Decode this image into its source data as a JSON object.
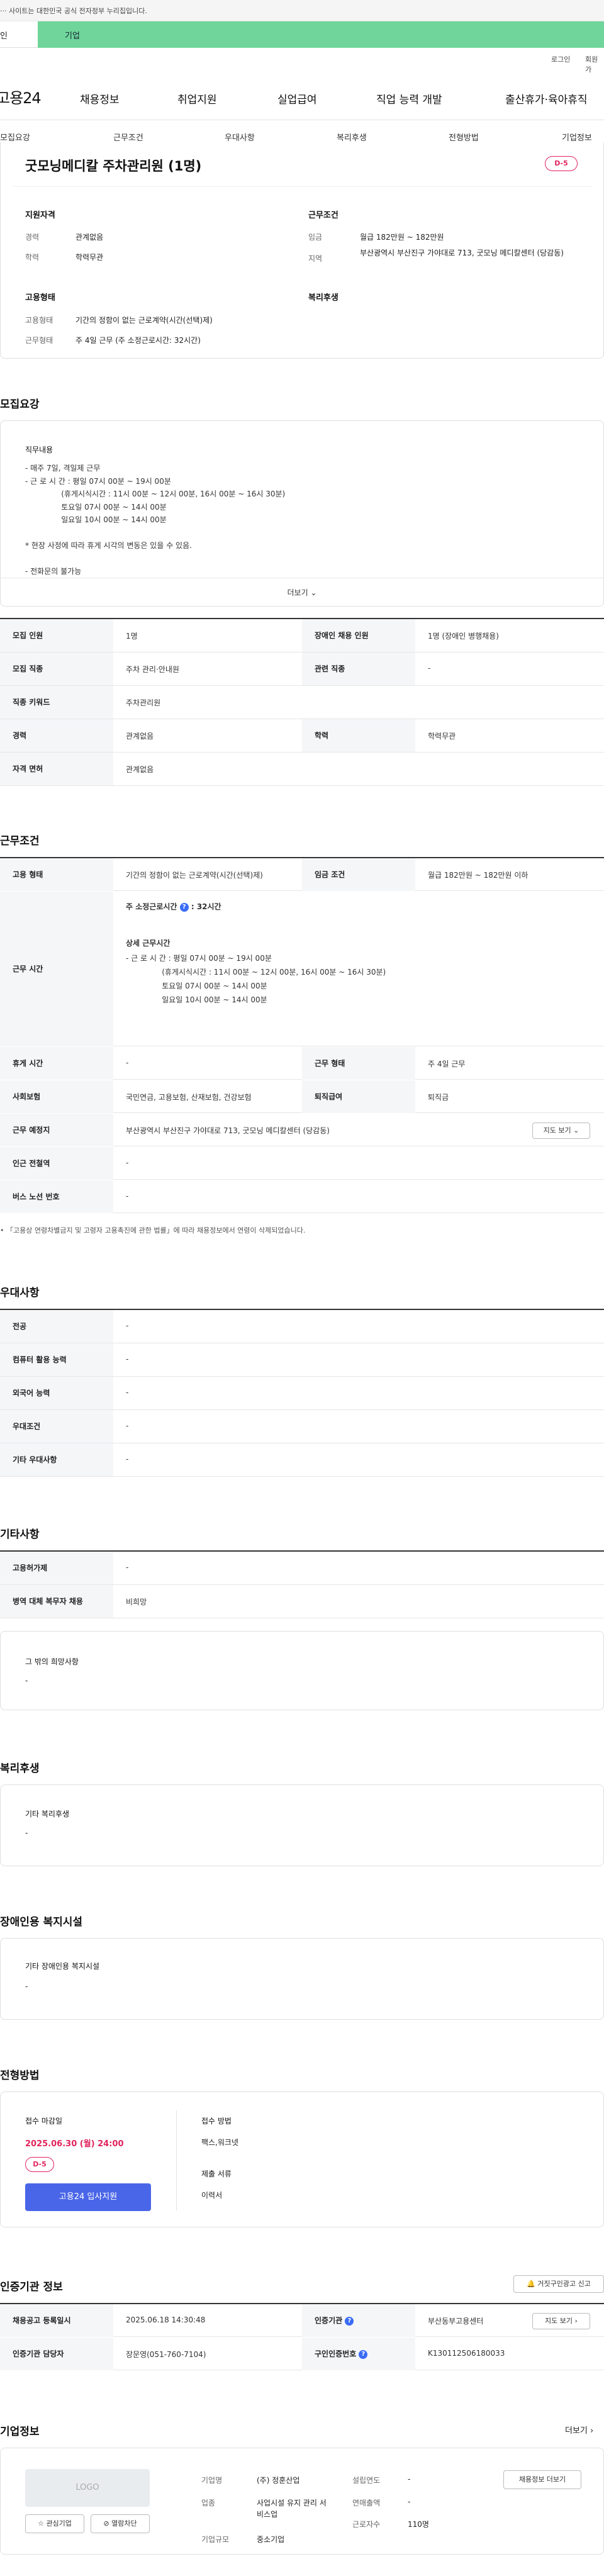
{
  "top": {
    "notice": "··· 사이트는 대한민국 공식 전자정부 누리집입니다.",
    "tab_individual": "인",
    "tab_business": "기업"
  },
  "util": {
    "login": "로그인",
    "join": "회원가"
  },
  "header": {
    "logo": "고용24",
    "gnb": [
      "채용정보",
      "취업지원",
      "실업급여",
      "직업 능력 개발",
      "출산휴가·육아휴직"
    ]
  },
  "snb": [
    "모집요강",
    "근무조건",
    "우대사항",
    "복리후생",
    "전형방법",
    "기업정보"
  ],
  "summary": {
    "title": "굿모닝메디칼 주차관리원 (1명)",
    "dday": "D-5",
    "qual_title": "지원자격",
    "career_k": "경력",
    "career_v": "관계없음",
    "edu_k": "학력",
    "edu_v": "학력무관",
    "cond_title": "근무조건",
    "wage_k": "임금",
    "wage_v": "월급 182만원 ~ 182만원",
    "loc_k": "지역",
    "loc_v": "부산광역시 부산진구 가야대로 713, 굿모닝 메디칼센터 (당감동)",
    "emp_title": "고용형태",
    "emptype_k": "고용형태",
    "emptype_v": "기간의 정함이 없는 근로계약(시간(선택)제)",
    "work_k": "근무형태",
    "work_v": "주 4일 근무 (주 소정근로시간: 32시간)",
    "welfare_title": "복리후생"
  },
  "recruit": {
    "title": "모집요강",
    "duty_title": "직무내용",
    "duty": "- 매주 7일, 격일제 근무\n- 근 로 시 간 : 평일 07시 00분 ~ 19시 00분\n               (휴게시식시간 : 11시 00분 ~ 12시 00분, 16시 00분 ~ 16시 30분)\n               토요일 07시 00분 ~ 14시 00분\n               일요일 10시 00분 ~ 14시 00분\n\n* 현장 사정에 따라 휴게 시각의 변동은 있을 수 있음.\n\n- 전화문의 불가능",
    "more": "더보기",
    "rows": [
      [
        "모집 인원",
        "1명",
        "장애인 채용 인원",
        "1명 (장애인 병행채용)"
      ],
      [
        "모집 직종",
        "주차 관리·안내원",
        "관련 직종",
        "-"
      ],
      [
        "직종 키워드",
        "주차관리원"
      ],
      [
        "경력",
        "관계없음",
        "학력",
        "학력무관"
      ],
      [
        "자격 면허",
        "관계없음"
      ]
    ]
  },
  "work": {
    "title": "근무조건",
    "emp_k": "고용 형태",
    "emp_v": "기간의 정함이 없는 근로계약(시간(선택)제)",
    "wage_k": "임금 조건",
    "wage_v": "월급 182만원 ~ 182만원 이하",
    "hours_k": "근무 시간",
    "hours_week": "주 소정근로시간",
    "hours_week_v": ": 32시간",
    "hours_detail_t": "상세 근무시간",
    "hours_detail": "- 근 로 시 간 : 평일 07시 00분 ~ 19시 00분\n               (휴게시식시간 : 11시 00분 ~ 12시 00분, 16시 00분 ~ 16시 30분)\n               토요일 07시 00분 ~ 14시 00분\n               일요일 10시 00분 ~ 14시 00분",
    "rest_k": "휴게 시간",
    "rest_v": "-",
    "form_k": "근무 형태",
    "form_v": "주 4일 근무",
    "ins_k": "사회보험",
    "ins_v": "국민연금, 고용보험, 산재보험, 건강보험",
    "sev_k": "퇴직급여",
    "sev_v": "퇴직금",
    "place_k": "근무 예정지",
    "place_v": "부산광역시 부산진구 가야대로 713, 굿모닝 메디칼센터 (당감동)",
    "map_btn": "지도 보기",
    "subway_k": "인근 전철역",
    "subway_v": "-",
    "bus_k": "버스 노선 번호",
    "bus_v": "-",
    "footnote": "「고용상 연령차별금지 및 고령자 고용촉진에 관한 법률」에 따라 채용정보에서 연령이 삭제되었습니다."
  },
  "pref": {
    "title": "우대사항",
    "rows": [
      [
        "전공",
        "-"
      ],
      [
        "컴퓨터 활용 능력",
        "-"
      ],
      [
        "외국어 능력",
        "-"
      ],
      [
        "우대조건",
        "-"
      ],
      [
        "기타 우대사항",
        "-"
      ]
    ]
  },
  "etc": {
    "title": "기타사항",
    "rows": [
      [
        "고용허가제",
        "-"
      ],
      [
        "병역 대체 복무자 채용",
        "비희망"
      ]
    ],
    "hope_t": "그 밖의 희망사항",
    "hope_v": "-"
  },
  "welfare": {
    "title": "복리후생",
    "box_t": "기타 복리후생",
    "box_v": "-"
  },
  "disab": {
    "title": "장애인용 복지시설",
    "box_t": "기타 장애인용 복지시설",
    "box_v": "-"
  },
  "process": {
    "title": "전형방법",
    "deadline_t": "접수 마감일",
    "deadline_v": "2025.06.30 (월) 24:00",
    "dday": "D-5",
    "apply": "고용24 입사지원",
    "method_t": "접수 방법",
    "method_v": "팩스,워크넷",
    "docs_t": "제출 서류",
    "docs_v": "이력서"
  },
  "agency": {
    "title": "인증기관 정보",
    "report": "거짓구인광고 신고",
    "rows": [
      [
        "채용공고 등록일시",
        "2025.06.18 14:30:48",
        "인증기관",
        "부산동부고용센터"
      ],
      [
        "인증기관 담당자",
        "장문영(051-760-7104)",
        "구인인증번호",
        "K130112506180033"
      ]
    ],
    "map_btn": "지도 보기"
  },
  "company": {
    "title": "기업정보",
    "more": "더보기",
    "logo": "LOGO",
    "fav": "관심기업",
    "block": "열람차단",
    "name_k": "기업명",
    "name_v": "(주) 정훈산업",
    "ind_k": "업종",
    "ind_v": "사업시설 유지 관리 서비스업",
    "size_k": "기업규모",
    "size_v": "중소기업",
    "year_k": "설립연도",
    "year_v": "-",
    "sales_k": "연매출액",
    "sales_v": "-",
    "staff_k": "근로자수",
    "staff_v": "110명",
    "jobs_btn": "채용정보 더보기"
  }
}
